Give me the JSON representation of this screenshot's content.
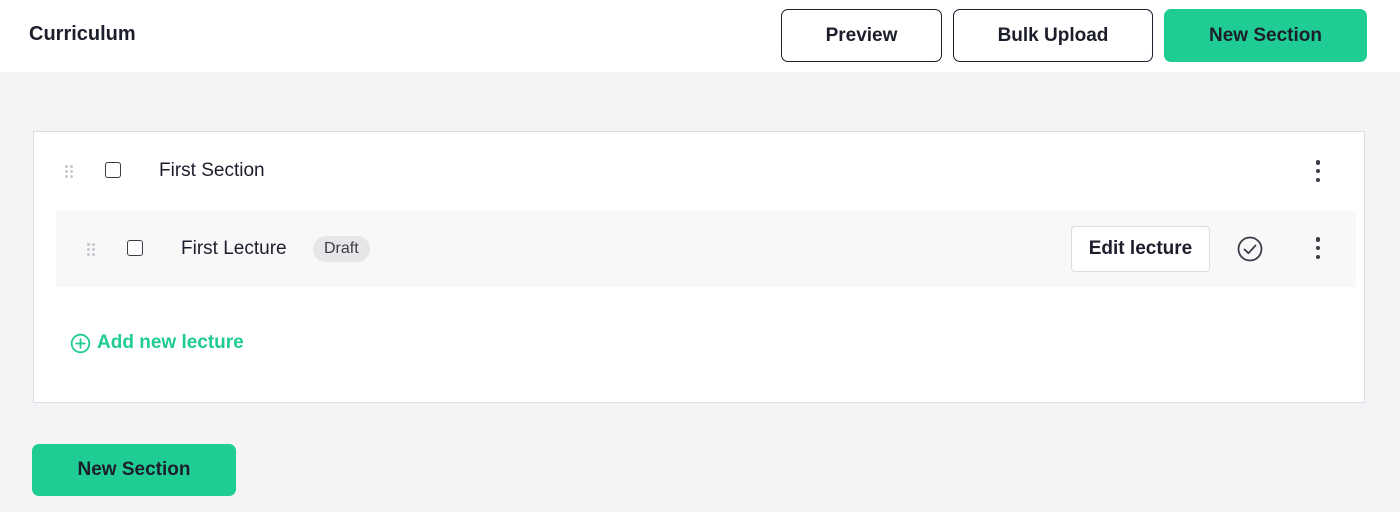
{
  "header": {
    "title": "Curriculum",
    "preview_label": "Preview",
    "bulk_upload_label": "Bulk Upload",
    "new_section_label": "New Section"
  },
  "sections": [
    {
      "title": "First Section",
      "lectures": [
        {
          "title": "First Lecture",
          "status": "Draft",
          "edit_label": "Edit lecture"
        }
      ],
      "add_lecture_label": "Add new lecture"
    }
  ],
  "footer": {
    "new_section_label": "New Section"
  },
  "colors": {
    "accent": "#1fcc94",
    "text": "#1d1e2c",
    "background": "#f4f4f6"
  },
  "icons": [
    "drag-handle-icon",
    "kebab-menu-icon",
    "check-circle-icon",
    "plus-circle-icon"
  ]
}
